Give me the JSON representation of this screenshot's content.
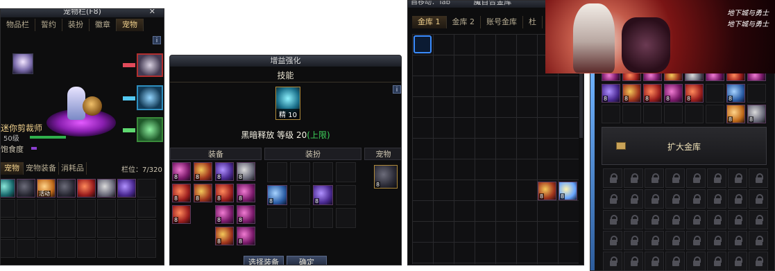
{
  "panel1": {
    "title": "宠物栏(F8)",
    "tabs": [
      "物品栏",
      "誓约",
      "装扮",
      "徽章",
      "宠物"
    ],
    "pet_name": "迷你剪裁师",
    "pet_level": "50级",
    "satiety_label": "饱食度",
    "lower_tabs": [
      "宠物",
      "宠物装备",
      "消耗品"
    ],
    "slot_count": "栏位：7/320",
    "pet_item_badge": "活动",
    "close_glyph": "✕",
    "info_glyph": "i"
  },
  "panel2": {
    "title": "增益强化",
    "skill_header": "技能",
    "skill_badge": "精 10",
    "skill_name": "黑暗释放 等级 20",
    "skill_limit": "(上限)",
    "col_equip": "装备",
    "col_avatar": "装扮",
    "col_pet": "宠物",
    "btn_select": "选择装备",
    "btn_confirm": "确定",
    "info_glyph": "i"
  },
  "panel3": {
    "title": "魔百合金库",
    "title_left": "自移动：Tab",
    "tabs": [
      "金库 1",
      "金库 2",
      "账号金库",
      "杜"
    ]
  },
  "panel4": {
    "expand_label": "扩大金库",
    "banner_logo_1": "地下城与勇士",
    "banner_logo_2": "地下城与勇士"
  },
  "colors": {
    "gold_text": "#f0d08c",
    "green_text": "#3ed05a",
    "accent_blue": "#3a8cff"
  }
}
